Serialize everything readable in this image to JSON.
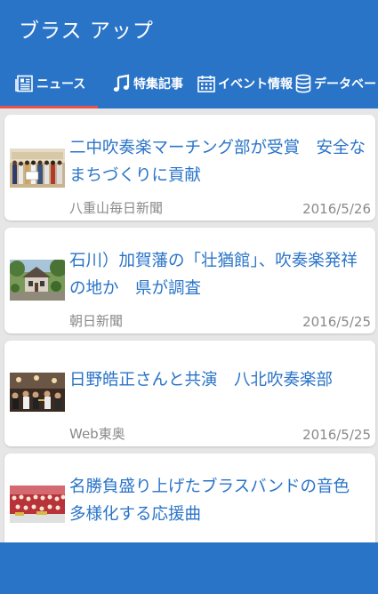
{
  "app": {
    "title": "ブラス アップ"
  },
  "tabs": [
    {
      "label": "ニュース",
      "icon": "newspaper-icon",
      "selected": true
    },
    {
      "label": "特集記事",
      "icon": "music-note-icon",
      "selected": false
    },
    {
      "label": "イベント情報",
      "icon": "calendar-icon",
      "selected": false
    },
    {
      "label": "データベー",
      "icon": "database-icon",
      "selected": false
    }
  ],
  "news": [
    {
      "headline": "二中吹奏楽マーチング部が受賞　安全なまちづくりに貢献",
      "source": "八重山毎日新聞",
      "date": "2016/5/26",
      "thumbnail": "group-photo"
    },
    {
      "headline": "石川）加賀藩の「壮猶館」、吹奏楽発祥の地か　県が調査",
      "source": "朝日新聞",
      "date": "2016/5/25",
      "thumbnail": "building-photo"
    },
    {
      "headline": "日野皓正さんと共演　八北吹奏楽部",
      "source": "Web東奥",
      "date": "2016/5/25",
      "thumbnail": "concert-photo"
    },
    {
      "headline": "名勝負盛り上げたブラスバンドの音色　多様化する応援曲",
      "source": "",
      "date": "",
      "thumbnail": "stadium-band-photo"
    }
  ],
  "colors": {
    "primary": "#2a74c8",
    "accent": "#e8524e",
    "link_text": "#2a74c8",
    "meta_text": "#8a8a8a"
  }
}
